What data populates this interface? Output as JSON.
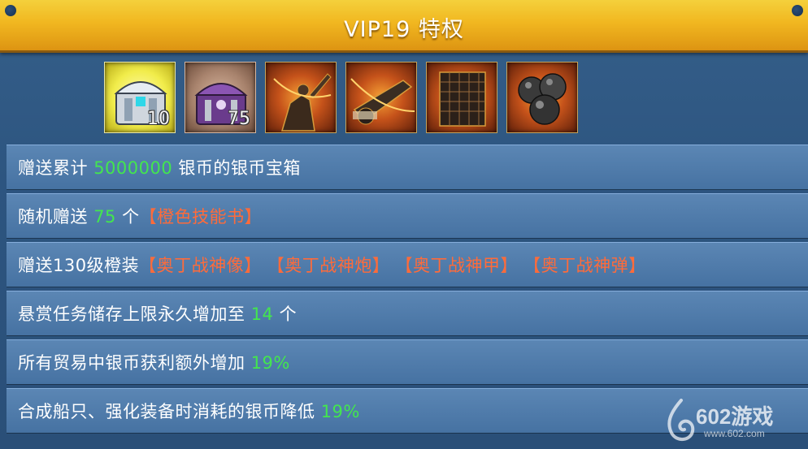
{
  "title": "VIP19 特权",
  "rewards": [
    {
      "icon": "silver-chest-icon",
      "count": "10"
    },
    {
      "icon": "purple-chest-icon",
      "count": "75"
    },
    {
      "icon": "odin-statue-icon",
      "count": ""
    },
    {
      "icon": "odin-cannon-icon",
      "count": ""
    },
    {
      "icon": "odin-armor-icon",
      "count": ""
    },
    {
      "icon": "odin-cannonballs-icon",
      "count": ""
    }
  ],
  "rows": {
    "r1": {
      "a": "赠送累计 ",
      "b": "5000000",
      "c": " 银币的银币宝箱"
    },
    "r2": {
      "a": "随机赠送 ",
      "b": "75",
      "c": " 个",
      "d": "【橙色技能书】"
    },
    "r3": {
      "a": "赠送130级橙装",
      "b": "【奥丁战神像】",
      "c": "【奥丁战神炮】",
      "d": "【奥丁战神甲】",
      "e": "【奥丁战神弹】"
    },
    "r4": {
      "a": "悬赏任务储存上限永久增加至 ",
      "b": "14",
      "c": " 个"
    },
    "r5": {
      "a": "所有贸易中银币获利额外增加 ",
      "b": "19%"
    },
    "r6": {
      "a": "合成船只、强化装备时消耗的银币降低 ",
      "b": "19%"
    }
  },
  "watermark": {
    "name": "602游戏",
    "url": "www.602.com"
  },
  "colors": {
    "title_bar": "#f1b720",
    "row_bg": "#4f7cac",
    "highlight_green": "#43e64e",
    "highlight_orange": "#ff6b3a"
  }
}
